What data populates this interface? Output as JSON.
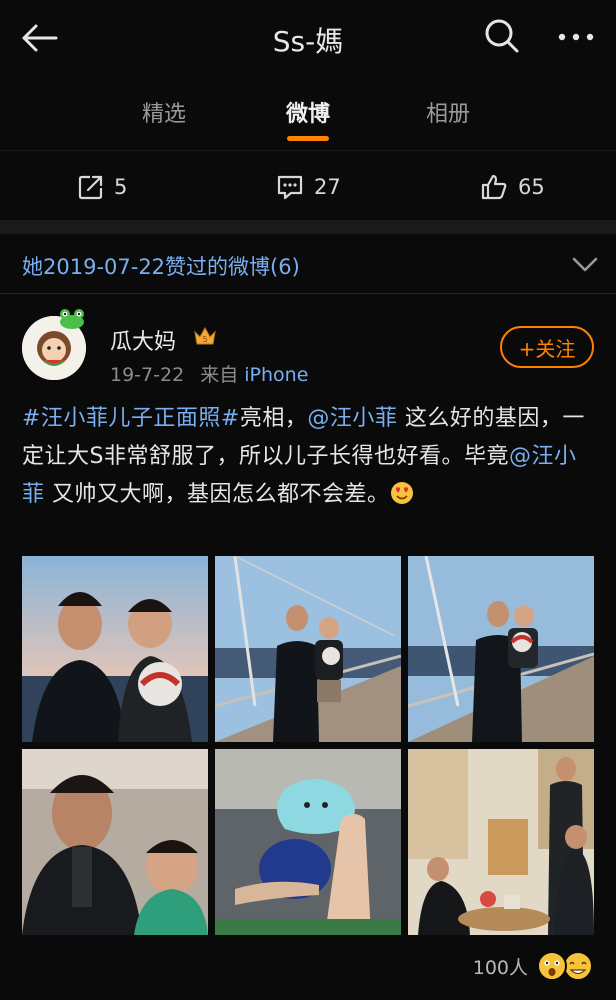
{
  "header": {
    "title": "Ss-媽",
    "back_icon": "arrow-left-icon",
    "search_icon": "search-icon",
    "more_icon": "more-dots-icon"
  },
  "tabs": [
    {
      "label": "精选",
      "active": false
    },
    {
      "label": "微博",
      "active": true
    },
    {
      "label": "相册",
      "active": false
    }
  ],
  "stats": {
    "reposts": "5",
    "comments": "27",
    "likes": "65"
  },
  "liked_header": {
    "text": "她2019-07-22赞过的微博(6)"
  },
  "post": {
    "author": "瓜大妈",
    "date": "19-7-22",
    "source_prefix": "来自",
    "source": "iPhone",
    "follow_label": "+关注",
    "text": {
      "hashtag": "#汪小菲儿子正面照#",
      "part1": "亮相，",
      "mention1": "@汪小菲",
      "part2": " 这么好的基因，一定让大S非常舒服了，所以儿子长得也好看。毕竟",
      "mention2": "@汪小菲",
      "part3": " 又帅又大啊，基因怎么都不会差。"
    },
    "photos": [
      {
        "name": "man-and-boy-sunset-photo"
      },
      {
        "name": "man-holding-boy-ship-deck-photo"
      },
      {
        "name": "man-holding-boy-railing-photo"
      },
      {
        "name": "man-and-boy-closeup-photo"
      },
      {
        "name": "legs-on-sofa-photo"
      },
      {
        "name": "family-living-room-photo"
      }
    ],
    "reactions_count": "100人"
  },
  "colors": {
    "accent": "#ff8200",
    "link": "#7aaef0",
    "background": "#000000"
  }
}
